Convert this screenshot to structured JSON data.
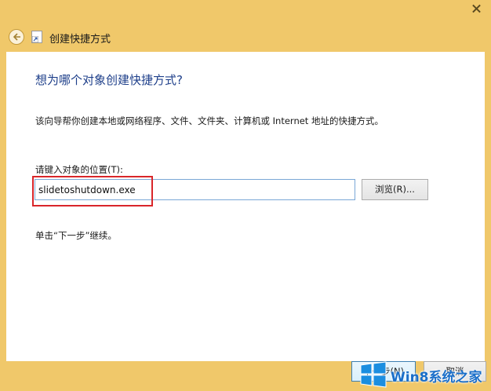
{
  "window": {
    "title": "创建快捷方式",
    "close_icon": "close-icon"
  },
  "header": {
    "back_icon": "back-arrow-icon",
    "shortcut_icon": "shortcut-icon"
  },
  "main": {
    "question": "想为哪个对象创建快捷方式?",
    "description": "该向导帮你创建本地或网络程序、文件、文件夹、计算机或 Internet 地址的快捷方式。",
    "location_label": "请键入对象的位置(T):",
    "location_value": "slidetoshutdown.exe",
    "browse_label": "浏览(R)...",
    "hint": "单击“下一步”继续。"
  },
  "footer": {
    "next_label": "下一步(N)",
    "cancel_label": "取消"
  },
  "watermark": {
    "text": "Win8系统之家"
  },
  "colors": {
    "frame": "#f0c86a",
    "heading": "#1e3f8a",
    "highlight": "#d9262a",
    "input_border": "#7aa7d6"
  }
}
